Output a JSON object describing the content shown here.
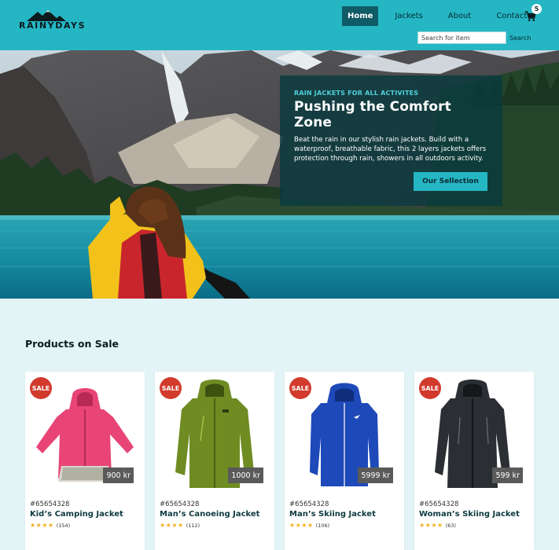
{
  "header": {
    "logo_text": "RAINYDAYS",
    "nav": [
      {
        "label": "Home"
      },
      {
        "label": "Jackets"
      },
      {
        "label": "About"
      },
      {
        "label": "Contact"
      }
    ],
    "cart_count": "5",
    "search_placeholder": "Search for item",
    "search_label": "Search",
    "colors": {
      "header_bg": "#25b6c4",
      "active_nav": "#0f5b66"
    }
  },
  "hero": {
    "eyebrow": "RAIN JACKETS FOR ALL ACTIVITES",
    "title": "Pushing the Comfort Zone",
    "text": "Beat the rain in our stylish rain jackets. Build with a waterproof, breathable fabric, this 2 layers jackets offers protection through rain, showers in all outdoors activity.",
    "cta": "Our Sellection"
  },
  "products_section": {
    "title": "Products on Sale",
    "products": [
      {
        "badge": "SALE",
        "price": "900 kr",
        "sku": "#65654328",
        "name": "Kid’s Camping Jacket",
        "stars": "★★★★",
        "reviews": "(154)",
        "jacket_color": "#e84576"
      },
      {
        "badge": "SALE",
        "price": "1000 kr",
        "sku": "#65654328",
        "name": "Man’s Canoeing Jacket",
        "stars": "★★★★",
        "reviews": "(112)",
        "jacket_color": "#6f8c22"
      },
      {
        "badge": "SALE",
        "price": "5999 kr",
        "sku": "#65654328",
        "name": "Man’s Skiing Jacket",
        "stars": "★★★★",
        "reviews": "(106)",
        "jacket_color": "#1e49b8"
      },
      {
        "badge": "SALE",
        "price": "599 kr",
        "sku": "#65654328",
        "name": "Woman’s Skiing Jacket",
        "stars": "★★★★",
        "reviews": "(63)",
        "jacket_color": "#2b2e33"
      }
    ]
  }
}
